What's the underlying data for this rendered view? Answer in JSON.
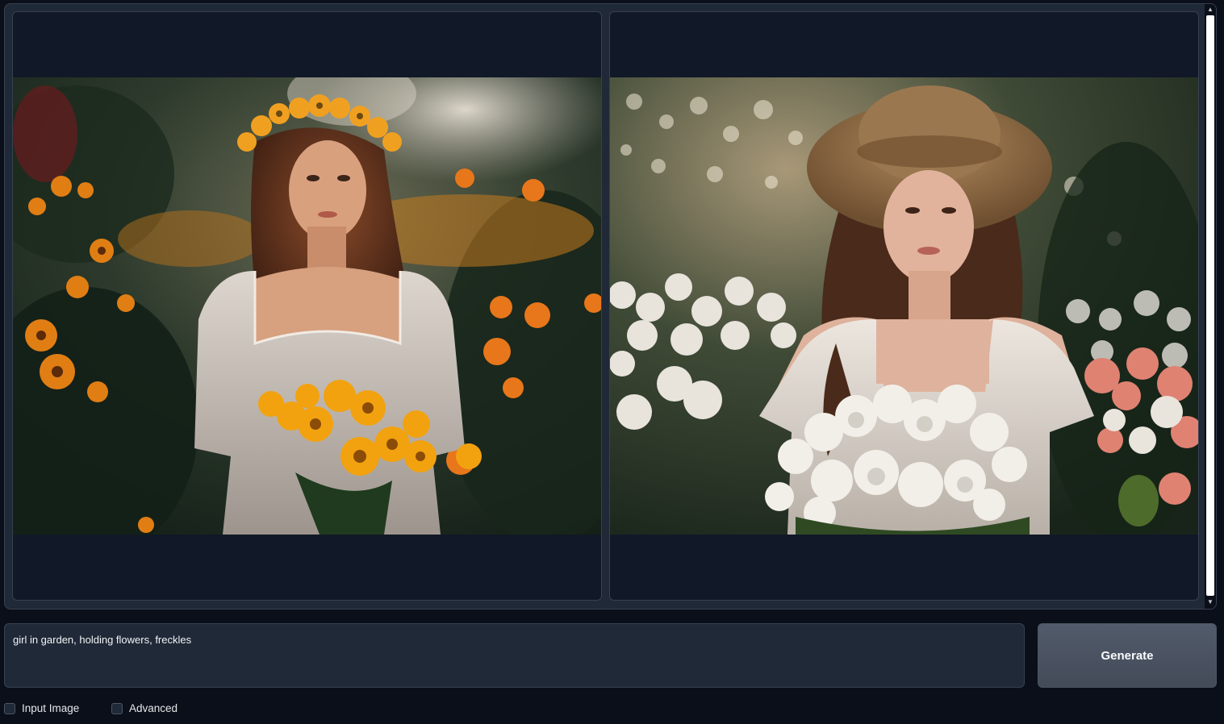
{
  "gallery": {
    "images": [
      {
        "alt": "",
        "subject": "woman in white lace dress with orange flower crown holding bouquet of yellow-orange flowers"
      },
      {
        "alt": "",
        "subject": "woman in straw hat and white dress holding bouquet of white flowers"
      }
    ]
  },
  "prompt": {
    "value": "girl in garden, holding flowers, freckles",
    "placeholder": ""
  },
  "generate_button": {
    "label": "Generate"
  },
  "options": {
    "input_image_label": "Input Image",
    "advanced_label": "Advanced",
    "input_image_checked": false,
    "advanced_checked": false
  },
  "colors": {
    "background": "#0b0f19",
    "panel": "#1f2937",
    "cell": "#111827",
    "border": "#374151",
    "button": "#4b5563"
  }
}
